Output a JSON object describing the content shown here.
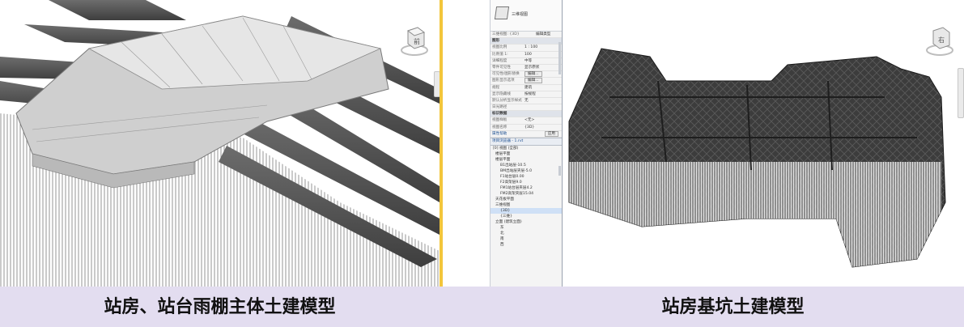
{
  "left_view": {
    "viewcube_label": "前"
  },
  "right_view": {
    "viewcube_label": "右",
    "properties": {
      "type_name": "三维视图",
      "view_selector": "三维视图: {3D}",
      "edit_type_label": "编辑类型",
      "section_graphics": "图形",
      "rows": [
        {
          "k": "视图比例",
          "v": "1 : 100"
        },
        {
          "k": "比例值 1:",
          "v": "100"
        },
        {
          "k": "详细程度",
          "v": "中等"
        },
        {
          "k": "零件可见性",
          "v": "显示原状"
        },
        {
          "k": "可见性/图形替换",
          "v": "编辑..."
        },
        {
          "k": "图形显示选项",
          "v": "编辑..."
        },
        {
          "k": "规程",
          "v": "建筑"
        },
        {
          "k": "显示隐藏线",
          "v": "按规程"
        },
        {
          "k": "默认分析显示样式",
          "v": "无"
        },
        {
          "k": "日光路径",
          "v": ""
        }
      ],
      "section_extents": "标识数据",
      "extents_rows": [
        {
          "k": "视图样板",
          "v": "<无>"
        },
        {
          "k": "视图名称",
          "v": "{3D}"
        }
      ],
      "help_link": "属性帮助",
      "apply_label": "应用",
      "browser_title": "项目浏览器 - 1.rvt",
      "tree": [
        {
          "level": "l0",
          "text": "[0] 视图 (全部)"
        },
        {
          "level": "l1",
          "text": "楼层平面"
        },
        {
          "level": "l1",
          "text": "楼层平面"
        },
        {
          "level": "l2",
          "text": "B1出站层-10.5"
        },
        {
          "level": "l2",
          "text": "BM出站层夹层-5.0"
        },
        {
          "level": "l2",
          "text": "F1站台层0.00"
        },
        {
          "level": "l2",
          "text": "F2高架层9.0"
        },
        {
          "level": "l2",
          "text": "FM1站台层夹层4.2"
        },
        {
          "level": "l2",
          "text": "FM2高架夹层15.04"
        },
        {
          "level": "l1",
          "text": "天花板平面"
        },
        {
          "level": "l1",
          "text": "三维视图"
        },
        {
          "level": "l2",
          "text": "{3D}"
        },
        {
          "level": "l2",
          "text": "{三维}"
        },
        {
          "level": "l1",
          "text": "立面 (建筑立面)"
        },
        {
          "level": "l2",
          "text": "东"
        },
        {
          "level": "l2",
          "text": "北"
        },
        {
          "level": "l2",
          "text": "南"
        },
        {
          "level": "l2",
          "text": "西"
        }
      ]
    }
  },
  "captions": {
    "left": "站房、站台雨棚主体土建模型",
    "right": "站房基坑土建模型"
  },
  "colors": {
    "caption_band": "#e3ddf0",
    "divider": "#f3c63b",
    "model_light": "#d8d8d8",
    "model_dark": "#2f2f2f"
  }
}
